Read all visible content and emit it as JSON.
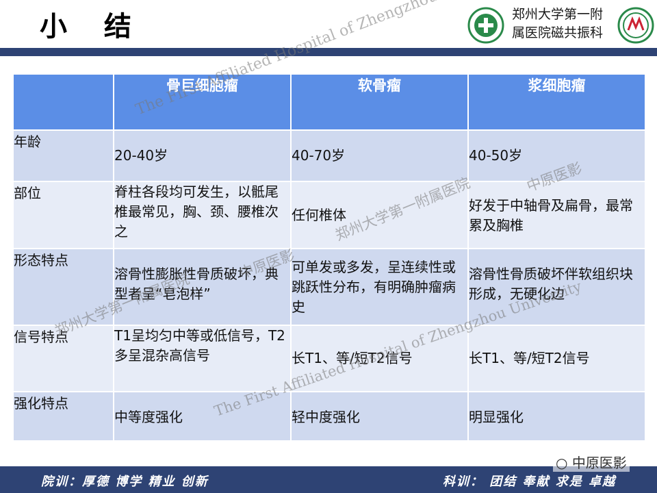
{
  "slide": {
    "title": "小  结",
    "hospital_name_line1": "郑州大学第一附",
    "hospital_name_line2": "属医院磁共振科"
  },
  "table": {
    "headers": [
      "",
      "骨巨细胞瘤",
      "软骨瘤",
      "浆细胞瘤"
    ],
    "rows": [
      {
        "label": "年龄",
        "cells": [
          "20-40岁",
          "40-70岁",
          "40-50岁"
        ]
      },
      {
        "label": "部位",
        "cells": [
          "脊柱各段均可发生，以骶尾椎最常见，胸、颈、腰椎次之",
          "任何椎体",
          "好发于中轴骨及扁骨，最常累及胸椎"
        ]
      },
      {
        "label": "形态特点",
        "cells": [
          "溶骨性膨胀性骨质破坏，典型者呈“皂泡样”",
          "可单发或多发，呈连续性或跳跃性分布，有明确肿瘤病史",
          "溶骨性骨质破坏伴软组织块形成，无硬化边"
        ]
      },
      {
        "label": "信号特点",
        "cells": [
          "T1呈均匀中等或低信号，T2多呈混杂高信号",
          "长T1、等/短T2信号",
          "长T1、等/短T2信号"
        ]
      },
      {
        "label": "强化特点",
        "cells": [
          "中等度强化",
          "轻中度强化",
          "明显强化"
        ]
      }
    ]
  },
  "watermarks": {
    "en1": "The First Affiliated Hospital of Zhengzhou University",
    "en2": "The First Affiliated Hospital of Zhengzhou University",
    "cn1": "郑州大学第一附属医院",
    "cn2": "郑州大学第一附属医院",
    "brand1": "中原医影",
    "brand2": "中原医影"
  },
  "footer": {
    "motto_left": "院训：厚德 博学 精业 创新",
    "motto_right": "科训： 团结 奉献 求是 卓越",
    "wechat_label": "中原医影"
  },
  "colors": {
    "header_bg": "#5b8ee6",
    "row_bg": "#cfd9ef",
    "row_alt_bg": "#e7ecf7",
    "bar_bg": "#2e4374"
  }
}
